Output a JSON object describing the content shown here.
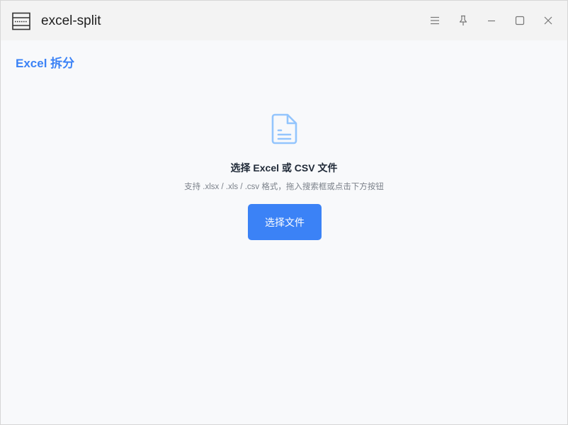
{
  "window": {
    "title": "excel-split",
    "controls": [
      "menu",
      "pin",
      "minimize",
      "maximize",
      "close"
    ]
  },
  "page": {
    "title": "Excel 拆分"
  },
  "drop_zone": {
    "icon": "file-document-icon",
    "heading": "选择 Excel 或 CSV 文件",
    "hint": "支持 .xlsx / .xls / .csv 格式，拖入搜索框或点击下方按钮",
    "button_label": "选择文件"
  },
  "colors": {
    "accent": "#3b82f6",
    "icon_light": "#93c5fd",
    "background": "#f8f9fb",
    "titlebar": "#f3f3f3"
  }
}
